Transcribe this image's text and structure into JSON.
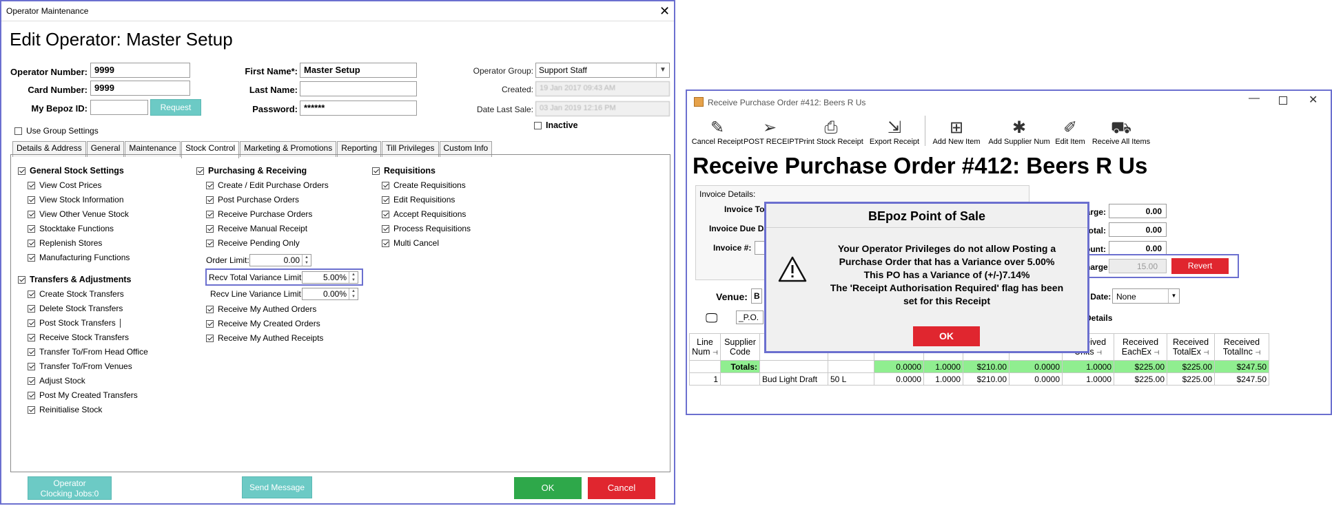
{
  "operator_window": {
    "window_title": "Operator Maintenance",
    "heading": "Edit Operator: Master Setup",
    "fields": {
      "operator_number_label": "Operator Number:",
      "operator_number": "9999",
      "card_number_label": "Card Number:",
      "card_number": "9999",
      "my_bepoz_id_label": "My Bepoz ID:",
      "my_bepoz_id": "",
      "request_button": "Request",
      "first_name_label": "First Name*:",
      "first_name": "Master Setup",
      "last_name_label": "Last Name:",
      "last_name": "",
      "password_label": "Password:",
      "password": "******",
      "operator_group_label": "Operator Group:",
      "operator_group": "Support Staff",
      "created_label": "Created:",
      "created": "19 Jan 2017 09:43 AM",
      "date_last_sale_label": "Date Last Sale:",
      "date_last_sale": "03 Jan 2019 12:16 PM",
      "inactive_label": "Inactive",
      "use_group_settings_label": "Use Group Settings"
    },
    "tabs": [
      "Details & Address",
      "General",
      "Maintenance",
      "Stock Control",
      "Marketing & Promotions",
      "Reporting",
      "Till Privileges",
      "Custom Info"
    ],
    "active_tab": "Stock Control",
    "col1": {
      "group1": "General Stock Settings",
      "items1": [
        "View Cost Prices",
        "View Stock Information",
        "View Other Venue Stock",
        "Stocktake Functions",
        "Replenish Stores",
        "Manufacturing Functions"
      ],
      "group2": "Transfers & Adjustments",
      "items2": [
        "Create Stock Transfers",
        "Delete Stock Transfers",
        "Post Stock Transfers",
        "Receive Stock Transfers",
        "Transfer To/From Head Office",
        "Transfer To/From Venues",
        "Adjust Stock",
        "Post My Created Transfers",
        "Reinitialise Stock"
      ]
    },
    "col2": {
      "group": "Purchasing & Receiving",
      "items": [
        "Create / Edit Purchase Orders",
        "Post Purchase Orders",
        "Receive Purchase Orders",
        "Receive Manual Receipt",
        "Receive Pending Only"
      ],
      "order_limit_label": "Order Limit:",
      "order_limit": "0.00",
      "recv_total_label": "Recv Total Variance Limit:",
      "recv_total": "5.00%",
      "recv_line_label": "Recv Line Variance Limit:",
      "recv_line": "0.00%",
      "items_after": [
        "Receive My Authed Orders",
        "Receive My Created Orders",
        "Receive My Authed Receipts"
      ]
    },
    "col3": {
      "group": "Requisitions",
      "items": [
        "Create Requisitions",
        "Edit Requisitions",
        "Accept Requisitions",
        "Process Requisitions",
        "Multi Cancel"
      ]
    },
    "footer": {
      "clocking_line1": "Operator",
      "clocking_line2": "Clocking Jobs:0",
      "send_message": "Send Message",
      "ok": "OK",
      "cancel": "Cancel"
    },
    "colors": {
      "teal": "#6ccac5",
      "green": "#2ea84a",
      "red": "#e0262f",
      "highlight": "#6b6fcf"
    }
  },
  "receive_window": {
    "window_title": "Receive Purchase Order #412: Beers R Us",
    "toolbar": [
      "Cancel Receipt",
      "POST RECEIPT",
      "Print Stock Receipt",
      "Export Receipt",
      "Add New Item",
      "Add Supplier Num",
      "Edit Item",
      "Receive All Items"
    ],
    "heading": "Receive Purchase Order #412: Beers R Us",
    "invoice_details_label": "Invoice Details:",
    "invoice_total_label": "Invoice To",
    "invoice_due_label": "Invoice Due Da",
    "invoice_num_label": "Invoice #:",
    "finance_charge_label": "Finance Charge:",
    "finance_charge": "0.00",
    "freight_total_label": "Freight Total:",
    "freight_total": "0.00",
    "invoice_discount_label": "Invoice Discount:",
    "invoice_discount": "0.00",
    "item_extra_label": "Item Extra Charge:",
    "item_extra": "15.00",
    "revert_button": "Revert",
    "venue_label": "Venue:",
    "venue_value": "B",
    "stock_apply_label": "Stock Apply Date:",
    "stock_apply_value": "None",
    "show_invoice_label": "Show Invoice Details",
    "po_field": "_P.O.",
    "partial_zero": "0",
    "grid_headers": [
      "Line Num",
      "Supplier Code",
      "",
      "",
      "",
      "",
      "",
      "",
      "Received Units",
      "Received EachEx",
      "Received TotalEx",
      "Received TotalInc"
    ],
    "totals_row": [
      "",
      "Totals:",
      "",
      "",
      "0.0000",
      "1.0000",
      "$210.00",
      "0.0000",
      "1.0000",
      "$225.00",
      "$225.00",
      "$247.50"
    ],
    "data_row": [
      "1",
      "",
      "Bud Light Draft",
      "50 L",
      "0.0000",
      "1.0000",
      "$210.00",
      "0.0000",
      "1.0000",
      "$225.00",
      "$225.00",
      "$247.50"
    ]
  },
  "dialog": {
    "title": "BEpoz Point of Sale",
    "line1": "Your Operator Privileges do not allow Posting a",
    "line2": "Purchase Order that has a Variance over 5.00%",
    "line3": "This PO has a Variance of (+/-)7.14%",
    "line4": "The 'Receipt Authorisation Required' flag has been",
    "line5": "set for this Receipt",
    "ok": "OK"
  }
}
